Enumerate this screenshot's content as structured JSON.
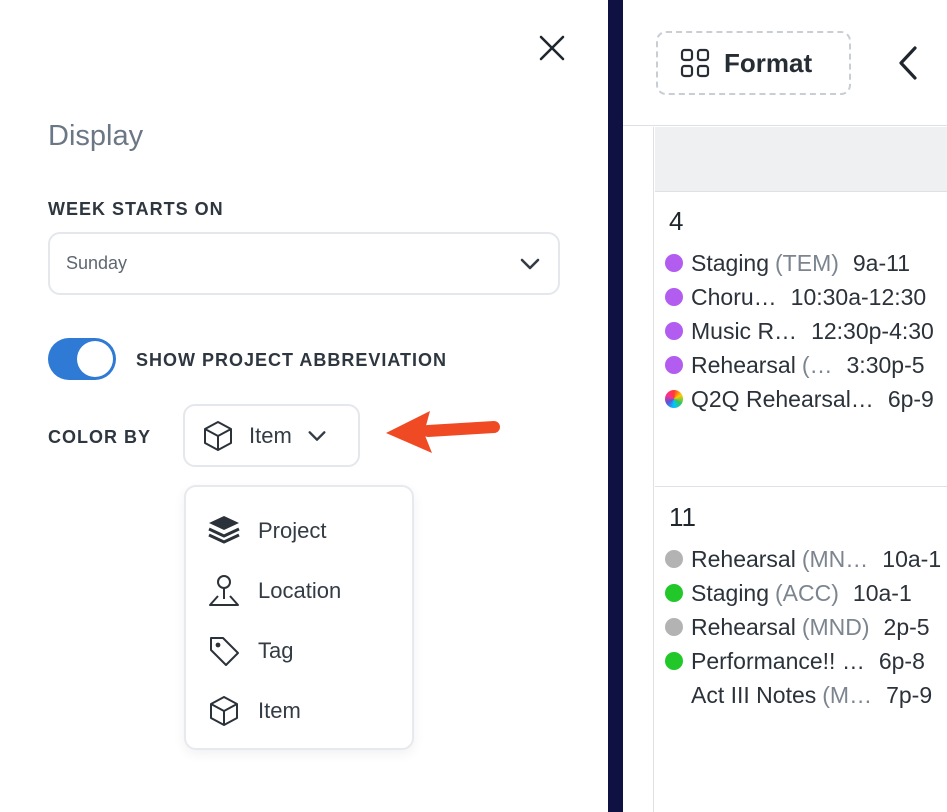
{
  "panel": {
    "title": "Display",
    "week_starts_label": "WEEK STARTS ON",
    "week_starts_value": "Sunday",
    "abbreviation_label": "SHOW PROJECT ABBREVIATION",
    "abbreviation_on": true,
    "color_by_label": "COLOR BY",
    "color_by_value": "Item",
    "arrow_color": "#f04a24",
    "toggle_color": "#2f7ad4",
    "menu": [
      {
        "label": "Project",
        "icon": "layers-icon"
      },
      {
        "label": "Location",
        "icon": "location-pin-icon"
      },
      {
        "label": "Tag",
        "icon": "tag-icon"
      },
      {
        "label": "Item",
        "icon": "cube-icon"
      }
    ]
  },
  "calendar": {
    "format_label": "Format",
    "weeks": [
      {
        "day": "4",
        "events": [
          {
            "title": "Staging",
            "abbr": "(TEM)",
            "time": "9a-11",
            "color": "#b25cf0"
          },
          {
            "title": "Choru…",
            "abbr": "",
            "time": "10:30a-12:30",
            "color": "#b25cf0"
          },
          {
            "title": "Music R…",
            "abbr": "",
            "time": "12:30p-4:30",
            "color": "#b25cf0"
          },
          {
            "title": "Rehearsal",
            "abbr": "(…",
            "time": "3:30p-5",
            "color": "#b25cf0"
          },
          {
            "title": "Q2Q Rehearsal…",
            "abbr": "",
            "time": "6p-9",
            "color": "multi"
          }
        ]
      },
      {
        "day": "11",
        "events": [
          {
            "title": "Rehearsal",
            "abbr": "(MN…",
            "time": "10a-1",
            "color": "#b3b3b3"
          },
          {
            "title": "Staging",
            "abbr": "(ACC)",
            "time": "10a-1",
            "color": "#22c82a"
          },
          {
            "title": "Rehearsal",
            "abbr": "(MND)",
            "time": "2p-5",
            "color": "#b3b3b3"
          },
          {
            "title": "Performance!! …",
            "abbr": "",
            "time": "6p-8",
            "color": "#22c82a"
          },
          {
            "title": "Act III Notes",
            "abbr": "(M…",
            "time": "7p-9",
            "color": "none"
          }
        ]
      }
    ]
  }
}
